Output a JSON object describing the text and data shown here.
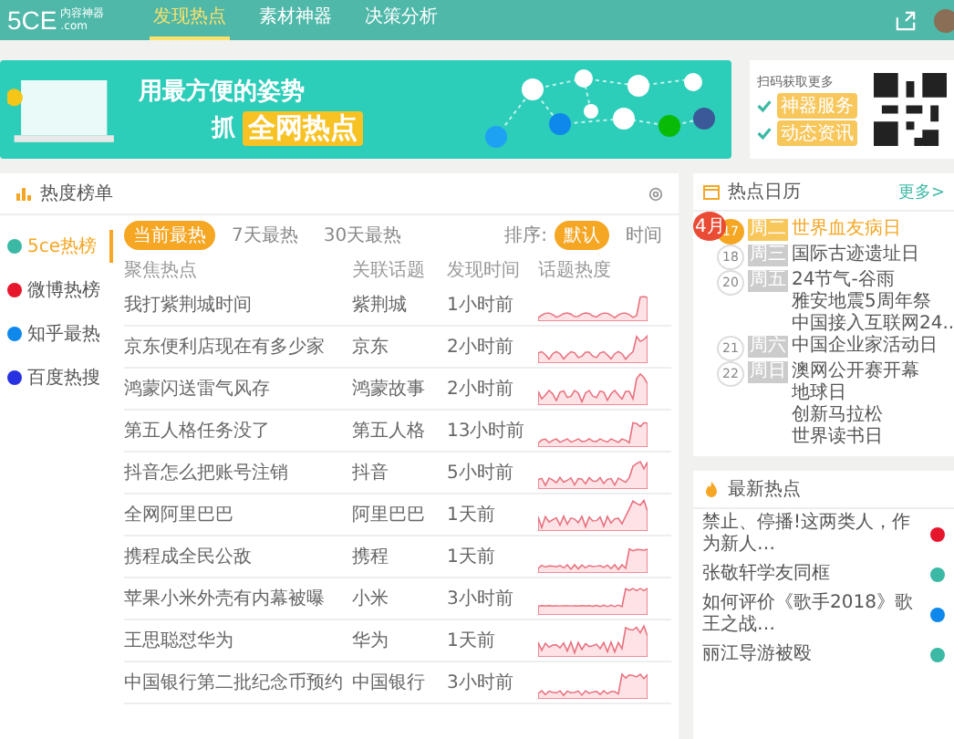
{
  "header": {
    "logo": "5CE",
    "logo_sub": "内容神器",
    "logo_domain": ".com",
    "nav": [
      {
        "label": "发现热点",
        "selected": true
      },
      {
        "label": "素材神器",
        "selected": false
      },
      {
        "label": "决策分析",
        "selected": false
      }
    ]
  },
  "banner": {
    "line1": "用最方便的姿势",
    "line2_prefix": "抓",
    "line2_highlight": "全网热点"
  },
  "qr_card": {
    "title": "扫码获取更多",
    "features": [
      "神器服务",
      "动态资讯"
    ]
  },
  "ranking": {
    "title": "热度榜单",
    "sources": [
      {
        "label": "5ce热榜",
        "kind": "own",
        "selected": true
      },
      {
        "label": "微博热榜",
        "kind": "weibo",
        "selected": false
      },
      {
        "label": "知乎最热",
        "kind": "zhihu",
        "selected": false
      },
      {
        "label": "百度热搜",
        "kind": "baidu",
        "selected": false
      }
    ],
    "ranges": [
      {
        "label": "当前最热",
        "selected": true
      },
      {
        "label": "7天最热",
        "selected": false
      },
      {
        "label": "30天最热",
        "selected": false
      }
    ],
    "sort_label": "排序:",
    "sort_options": [
      {
        "label": "默认",
        "selected": true
      },
      {
        "label": "时间",
        "selected": false
      }
    ],
    "columns": [
      "聚焦热点",
      "关联话题",
      "发现时间",
      "话题热度"
    ],
    "rows": [
      {
        "topic": "我打紫荆城时间",
        "related": "紫荆城",
        "time": "1小时前"
      },
      {
        "topic": "京东便利店现在有多少家",
        "related": "京东",
        "time": "2小时前"
      },
      {
        "topic": "鸿蒙闪送雷气风存",
        "related": "鸿蒙故事",
        "time": "2小时前"
      },
      {
        "topic": "第五人格任务没了",
        "related": "第五人格",
        "time": "13小时前"
      },
      {
        "topic": "抖音怎么把账号注销",
        "related": "抖音",
        "time": "5小时前"
      },
      {
        "topic": "全网阿里巴巴",
        "related": "阿里巴巴",
        "time": "1天前"
      },
      {
        "topic": "携程成全民公敌",
        "related": "携程",
        "time": "1天前"
      },
      {
        "topic": "苹果小米外壳有内幕被曝",
        "related": "小米",
        "time": "3小时前"
      },
      {
        "topic": "王思聪怼华为",
        "related": "华为",
        "time": "1天前"
      },
      {
        "topic": "中国银行第二批纪念币预约",
        "related": "中国银行",
        "time": "3小时前"
      }
    ]
  },
  "calendar": {
    "title": "热点日历",
    "more": "更多>",
    "month": "4月",
    "days": [
      {
        "day": "17",
        "weekday": "周二",
        "today": true,
        "events": [
          "世界血友病日"
        ]
      },
      {
        "day": "18",
        "weekday": "周三",
        "today": false,
        "events": [
          "国际古迹遗址日"
        ]
      },
      {
        "day": "20",
        "weekday": "周五",
        "today": false,
        "events": [
          "24节气-谷雨",
          "雅安地震5周年祭",
          "中国接入互联网24.."
        ]
      },
      {
        "day": "21",
        "weekday": "周六",
        "today": false,
        "events": [
          "中国企业家活动日"
        ]
      },
      {
        "day": "22",
        "weekday": "周日",
        "today": false,
        "events": [
          "澳网公开赛开幕",
          "地球日",
          "创新马拉松",
          "世界读书日"
        ]
      }
    ]
  },
  "latest": {
    "title": "最新热点",
    "items": [
      {
        "text": "禁止、停播!这两类人，作为新人…",
        "kind": "weibo"
      },
      {
        "text": "张敬轩学友同框",
        "kind": "own"
      },
      {
        "text": "如何评价《歌手2018》歌王之战…",
        "kind": "zhihu"
      },
      {
        "text": "丽江导游被殴",
        "kind": "own"
      }
    ]
  }
}
